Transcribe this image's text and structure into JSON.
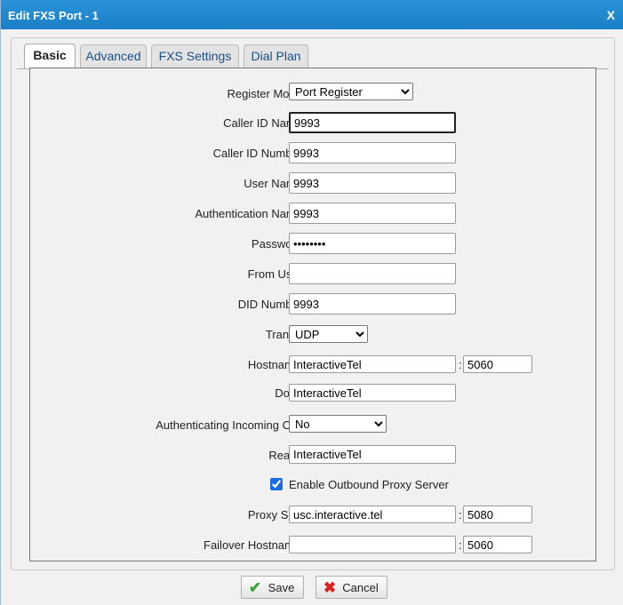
{
  "window": {
    "title": "Edit FXS Port - 1",
    "close": "X"
  },
  "tabs": [
    {
      "label": "Basic",
      "active": true
    },
    {
      "label": "Advanced",
      "active": false
    },
    {
      "label": "FXS Settings",
      "active": false
    },
    {
      "label": "Dial Plan",
      "active": false
    }
  ],
  "form": {
    "register_mode": {
      "label": "Register Mode",
      "value": "Port Register"
    },
    "caller_id_name": {
      "label": "Caller ID Name",
      "value": "9993"
    },
    "caller_id_number": {
      "label": "Caller ID Number",
      "value": "9993"
    },
    "user_name": {
      "label": "User Name",
      "value": "9993"
    },
    "auth_name": {
      "label": "Authentication Name",
      "value": "9993"
    },
    "password": {
      "label": "Password",
      "value": "••••••••"
    },
    "from_user": {
      "label": "From User",
      "value": ""
    },
    "did_number": {
      "label": "DID Number",
      "value": "9993"
    },
    "transport": {
      "label": "Transport",
      "value": "UDP"
    },
    "hostname": {
      "label": "Hostname/IP",
      "value": "InteractiveTel",
      "port": "5060"
    },
    "domain": {
      "label": "Domain",
      "value": "InteractiveTel"
    },
    "auth_incoming": {
      "label": "Authenticating Incoming Call",
      "value": "No"
    },
    "realm": {
      "label": "Realm",
      "value": "InteractiveTel"
    },
    "outbound_proxy": {
      "label": "Enable Outbound Proxy Server",
      "checked": true
    },
    "proxy_server": {
      "label": "Proxy Server",
      "value": "usc.interactive.tel",
      "port": "5080"
    },
    "failover": {
      "label": "Failover Hostname/IP",
      "value": "",
      "port": "5060"
    },
    "colon": ":"
  },
  "buttons": {
    "save": "Save",
    "cancel": "Cancel"
  },
  "icons": {
    "info": "info-icon",
    "save": "checkmark-icon",
    "cancel": "x-icon"
  },
  "colors": {
    "titlebar": "#1a7fc6",
    "tab_text": "#1c4f86"
  }
}
